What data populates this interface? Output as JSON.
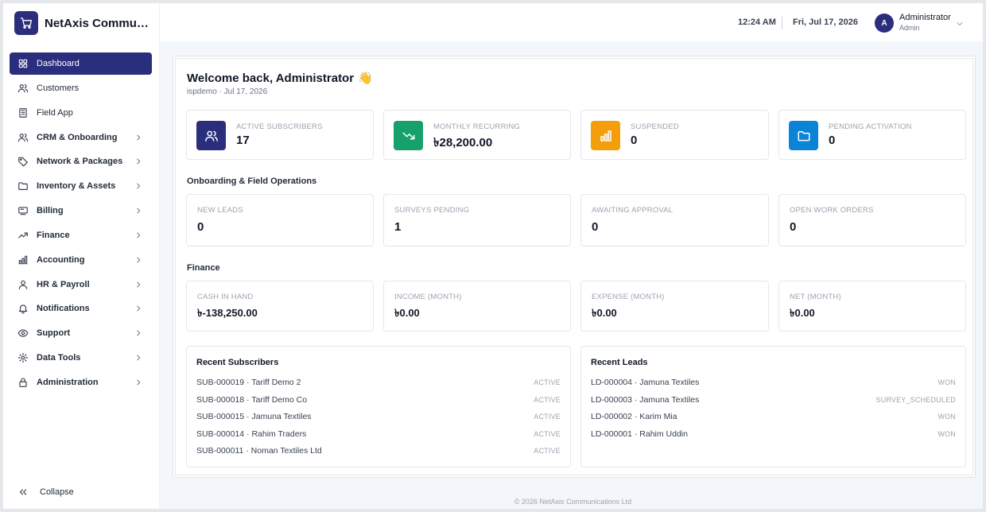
{
  "brand": {
    "name": "NetAxis Communications Ltd"
  },
  "sidebar": {
    "items": [
      {
        "label": "Dashboard",
        "icon": "grid-icon",
        "active": true,
        "expandable": false
      },
      {
        "label": "Customers",
        "icon": "users-icon",
        "active": false,
        "expandable": false
      },
      {
        "label": "Field App",
        "icon": "building-icon",
        "active": false,
        "expandable": false
      },
      {
        "label": "CRM & Onboarding",
        "icon": "users-icon",
        "active": false,
        "expandable": true
      },
      {
        "label": "Network & Packages",
        "icon": "tag-icon",
        "active": false,
        "expandable": true
      },
      {
        "label": "Inventory & Assets",
        "icon": "folder-icon",
        "active": false,
        "expandable": true
      },
      {
        "label": "Billing",
        "icon": "receipt-icon",
        "active": false,
        "expandable": true
      },
      {
        "label": "Finance",
        "icon": "trending-up-icon",
        "active": false,
        "expandable": true
      },
      {
        "label": "Accounting",
        "icon": "bar-chart-icon",
        "active": false,
        "expandable": true
      },
      {
        "label": "HR & Payroll",
        "icon": "user-icon",
        "active": false,
        "expandable": true
      },
      {
        "label": "Notifications",
        "icon": "bell-icon",
        "active": false,
        "expandable": true
      },
      {
        "label": "Support",
        "icon": "eye-icon",
        "active": false,
        "expandable": true
      },
      {
        "label": "Data Tools",
        "icon": "gear-icon",
        "active": false,
        "expandable": true
      },
      {
        "label": "Administration",
        "icon": "lock-icon",
        "active": false,
        "expandable": true
      }
    ],
    "collapse_label": "Collapse"
  },
  "header": {
    "time": "12:24 AM",
    "date": "Fri, Jul 17, 2026",
    "user_initial": "A",
    "user_name": "Administrator",
    "user_role": "Admin"
  },
  "welcome": {
    "title": "Welcome back, Administrator",
    "wave": "👋",
    "subline": "ispdemo · Jul 17, 2026"
  },
  "kpis": [
    {
      "label": "ACTIVE SUBSCRIBERS",
      "value": "17",
      "icon": "users-icon",
      "color": "#2a2e7c"
    },
    {
      "label": "MONTHLY RECURRING",
      "value": "৳28,200.00",
      "icon": "trending-down-icon",
      "color": "#16a06a"
    },
    {
      "label": "SUSPENDED",
      "value": "0",
      "icon": "bar-chart-icon",
      "color": "#f59e0b"
    },
    {
      "label": "PENDING ACTIVATION",
      "value": "0",
      "icon": "folder-icon",
      "color": "#0b84d8"
    }
  ],
  "onboarding": {
    "title": "Onboarding & Field Operations",
    "cards": [
      {
        "label": "NEW LEADS",
        "value": "0"
      },
      {
        "label": "SURVEYS PENDING",
        "value": "1"
      },
      {
        "label": "AWAITING APPROVAL",
        "value": "0"
      },
      {
        "label": "OPEN WORK ORDERS",
        "value": "0"
      }
    ]
  },
  "finance": {
    "title": "Finance",
    "cards": [
      {
        "label": "CASH IN HAND",
        "value": "৳-138,250.00"
      },
      {
        "label": "INCOME (MONTH)",
        "value": "৳0.00"
      },
      {
        "label": "EXPENSE (MONTH)",
        "value": "৳0.00"
      },
      {
        "label": "NET (MONTH)",
        "value": "৳0.00"
      }
    ]
  },
  "recent_subscribers": {
    "title": "Recent Subscribers",
    "rows": [
      {
        "text": "SUB-000019 · Tariff Demo 2",
        "status": "ACTIVE"
      },
      {
        "text": "SUB-000018 · Tariff Demo Co",
        "status": "ACTIVE"
      },
      {
        "text": "SUB-000015 · Jamuna Textiles",
        "status": "ACTIVE"
      },
      {
        "text": "SUB-000014 · Rahim Traders",
        "status": "ACTIVE"
      },
      {
        "text": "SUB-000011 · Noman Textiles Ltd",
        "status": "ACTIVE"
      }
    ]
  },
  "recent_leads": {
    "title": "Recent Leads",
    "rows": [
      {
        "text": "LD-000004 · Jamuna Textiles",
        "status": "WON"
      },
      {
        "text": "LD-000003 · Jamuna Textiles",
        "status": "SURVEY_SCHEDULED"
      },
      {
        "text": "LD-000002 · Karim Mia",
        "status": "WON"
      },
      {
        "text": "LD-000001 · Rahim Uddin",
        "status": "WON"
      }
    ]
  },
  "footer": {
    "text": "© 2026 NetAxis Communications Ltd"
  }
}
